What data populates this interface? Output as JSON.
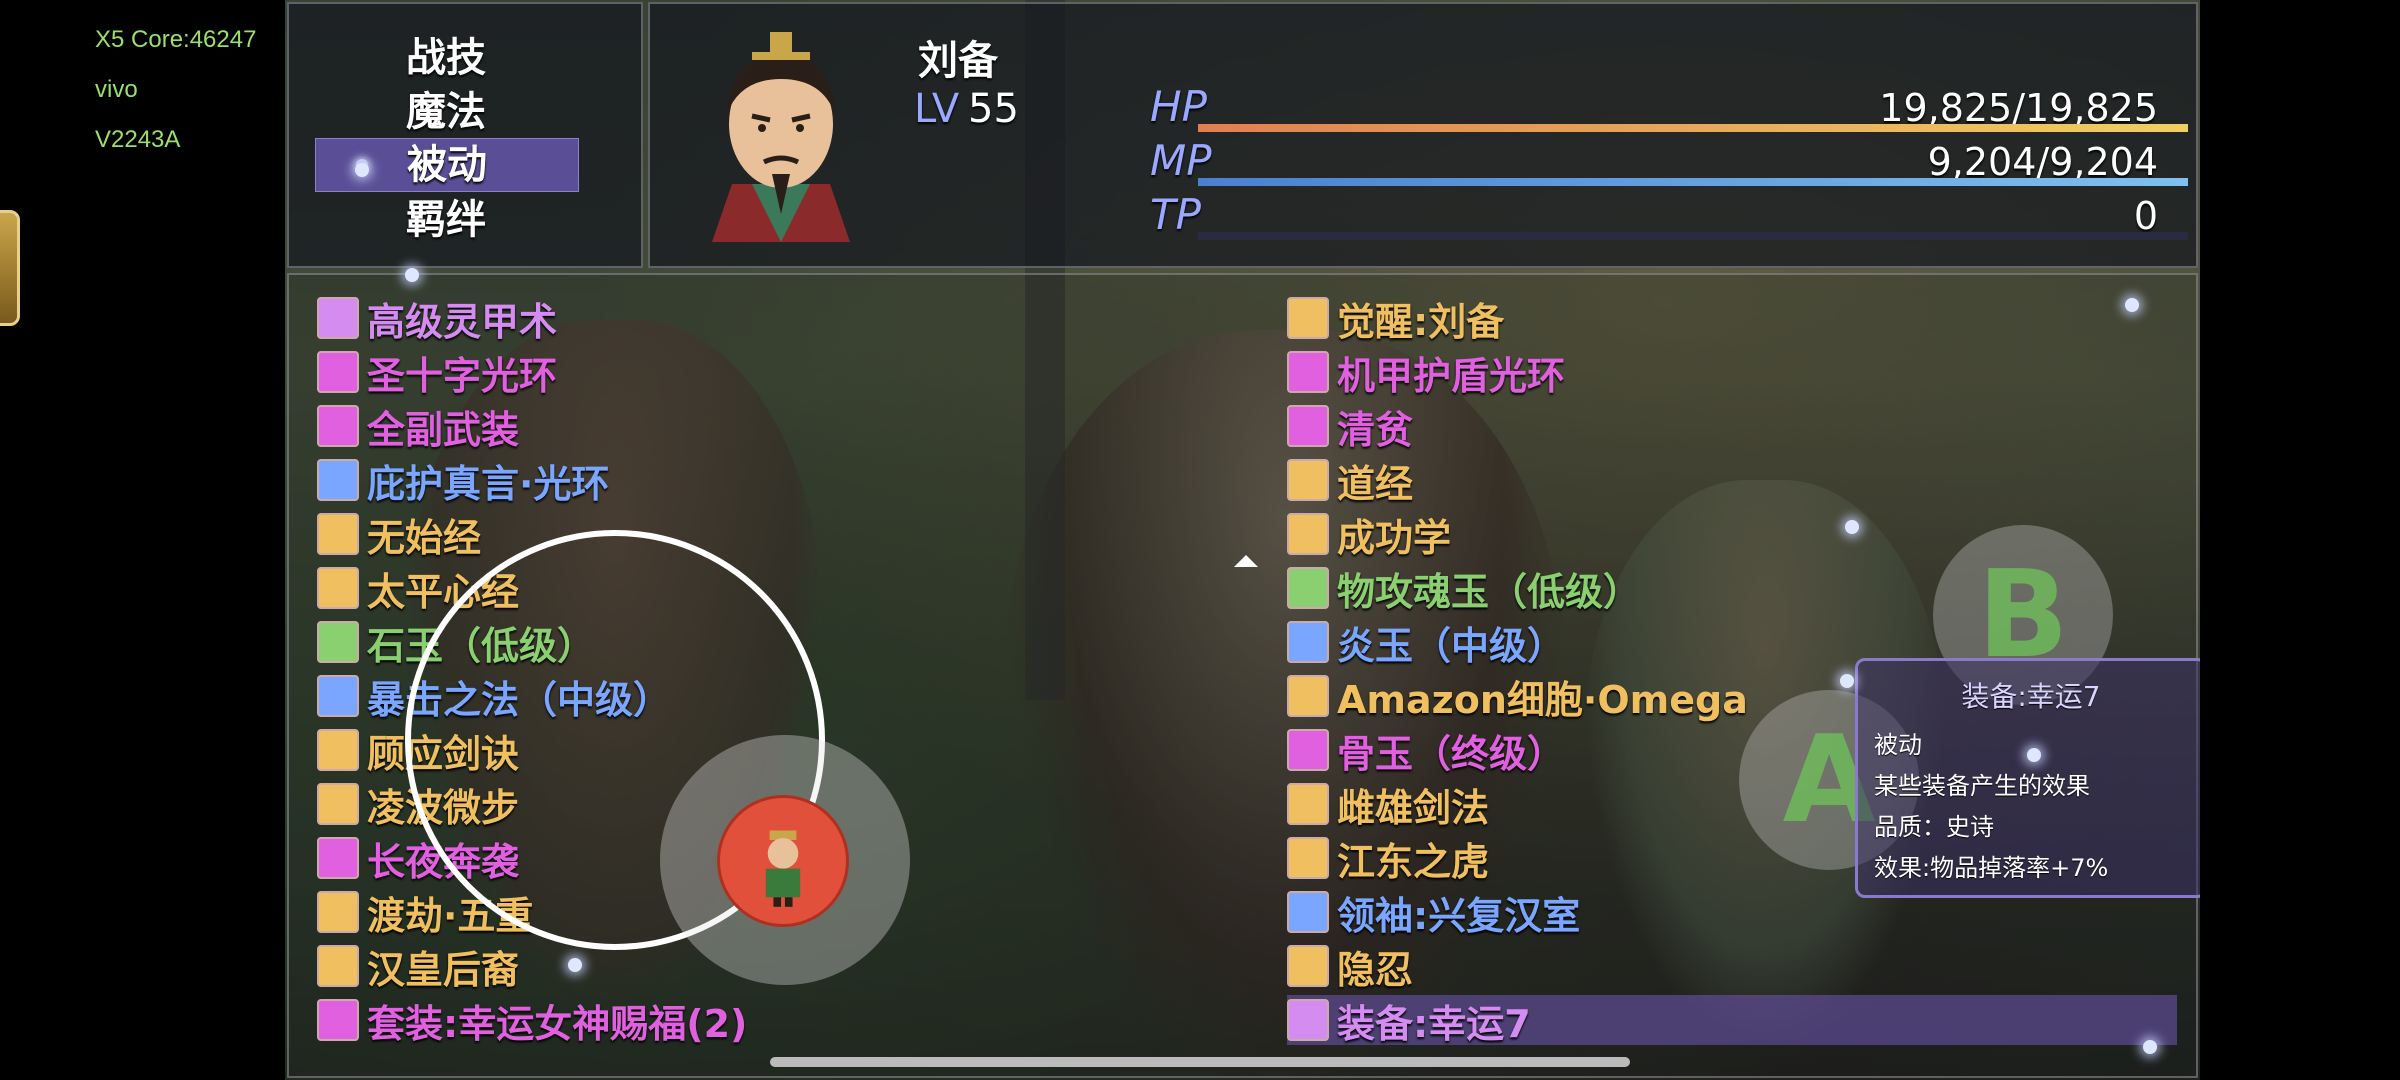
{
  "device": {
    "line1": "X5 Core:46247",
    "line2": "vivo",
    "line3": "V2243A"
  },
  "menu": {
    "items": [
      {
        "label": "战技"
      },
      {
        "label": "魔法"
      },
      {
        "label": "被动",
        "active": true
      },
      {
        "label": "羁绊"
      }
    ]
  },
  "actor": {
    "name": "刘备",
    "lv_label": "LV",
    "level": "55",
    "hp_label": "HP",
    "hp_value": "19,825/19,825",
    "hp_ratio": 1.0,
    "mp_label": "MP",
    "mp_value": "9,204/9,204",
    "mp_ratio": 1.0,
    "tp_label": "TP",
    "tp_value": "0",
    "tp_ratio": 0.0
  },
  "skills_left": [
    {
      "name": "高级灵甲术",
      "color": "#d58cf0",
      "icon": "armor-icon"
    },
    {
      "name": "圣十字光环",
      "color": "#e060e0",
      "icon": "cross-icon"
    },
    {
      "name": "全副武装",
      "color": "#e060e0",
      "icon": "weapon-icon"
    },
    {
      "name": "庇护真言·光环",
      "color": "#7aa6ff",
      "icon": "shield-icon"
    },
    {
      "name": "无始经",
      "color": "#f0c060",
      "icon": "demon-icon"
    },
    {
      "name": "太平心经",
      "color": "#f0c060",
      "icon": "book-icon"
    },
    {
      "name": "石玉（低级）",
      "color": "#8ad070",
      "icon": "stone-icon"
    },
    {
      "name": "暴击之法（中级）",
      "color": "#7aa6ff",
      "icon": "crit-book-icon"
    },
    {
      "name": "顾应剑诀",
      "color": "#f0c060",
      "icon": "sword-book-icon"
    },
    {
      "name": "凌波微步",
      "color": "#f0c060",
      "icon": "run-icon"
    },
    {
      "name": "长夜奔袭",
      "color": "#e060e0",
      "icon": "comet-icon"
    },
    {
      "name": "渡劫·五重",
      "color": "#f0c060",
      "icon": "swirl-icon"
    },
    {
      "name": "汉皇后裔",
      "color": "#f0c060",
      "icon": "emblem-icon"
    },
    {
      "name": "套装:幸运女神赐福(2)",
      "color": "#e060e0",
      "icon": "set-icon"
    }
  ],
  "skills_right": [
    {
      "name": "觉醒:刘备",
      "color": "#f0c060",
      "icon": "awaken-icon"
    },
    {
      "name": "机甲护盾光环",
      "color": "#e060e0",
      "icon": "mech-shield-icon"
    },
    {
      "name": "清贫",
      "color": "#e060e0",
      "icon": "hand-icon"
    },
    {
      "name": "道经",
      "color": "#f0c060",
      "icon": "meditate-icon"
    },
    {
      "name": "成功学",
      "color": "#f0c060",
      "icon": "success-icon"
    },
    {
      "name": "物攻魂玉（低级）",
      "color": "#8ad070",
      "icon": "soul-jade-icon"
    },
    {
      "name": "炎玉（中级）",
      "color": "#7aa6ff",
      "icon": "flame-icon"
    },
    {
      "name": "Amazon细胞·Omega",
      "color": "#f0c060",
      "icon": "cell-icon"
    },
    {
      "name": "骨玉（终级）",
      "color": "#e060e0",
      "icon": "bone-icon"
    },
    {
      "name": "雌雄剑法",
      "color": "#f0c060",
      "icon": "twin-sword-icon"
    },
    {
      "name": "江东之虎",
      "color": "#f0c060",
      "icon": "paw-icon"
    },
    {
      "name": "领袖:兴复汉室",
      "color": "#7aa6ff",
      "icon": "leader-icon"
    },
    {
      "name": "隐忍",
      "color": "#f0c060",
      "icon": "figures-icon"
    },
    {
      "name": "装备:幸运7",
      "color": "#d58cf0",
      "icon": "helmet-icon",
      "selected": true
    }
  ],
  "buttons": {
    "b_label": "B",
    "a_label": "A"
  },
  "help": {
    "title": "装备:幸运7",
    "type": "被动",
    "desc": "某些装备产生的效果",
    "quality": "品质：史诗",
    "effect": "效果:物品掉落率+7%"
  }
}
